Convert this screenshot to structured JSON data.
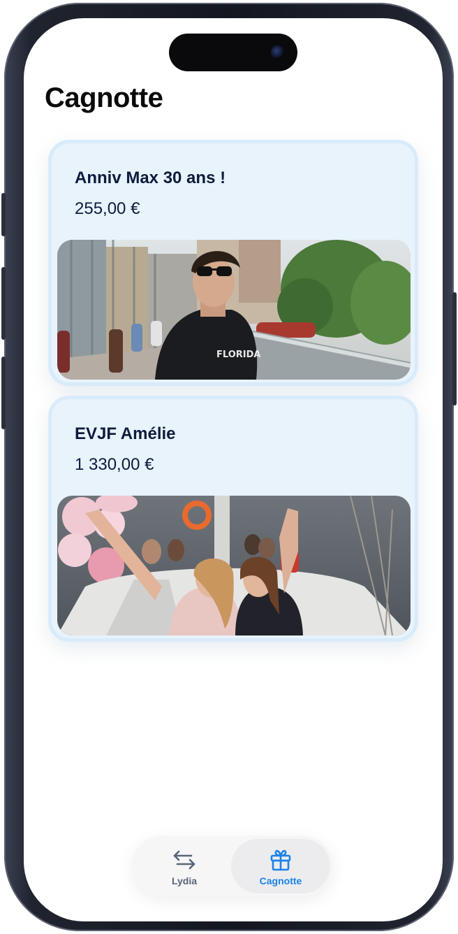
{
  "header": {
    "title": "Cagnotte"
  },
  "cards": [
    {
      "title": "Anniv Max 30 ans !",
      "amount": "255,00 €",
      "photo_icon": "photo-young-man-sunglasses"
    },
    {
      "title": "EVJF Amélie",
      "amount": "1 330,00 €",
      "photo_icon": "photo-women-on-boat"
    }
  ],
  "tabbar": {
    "tabs": [
      {
        "label": "Lydia",
        "icon": "transfer-arrows-icon",
        "color": "#5b6478",
        "active": false
      },
      {
        "label": "Cagnotte",
        "icon": "gift-icon",
        "color": "#1a82e8",
        "active": true
      }
    ]
  },
  "colors": {
    "card_background": "#e8f3fc",
    "card_border": "#d8ebfb",
    "text_primary": "#0f1b3d",
    "accent": "#1a82e8"
  }
}
